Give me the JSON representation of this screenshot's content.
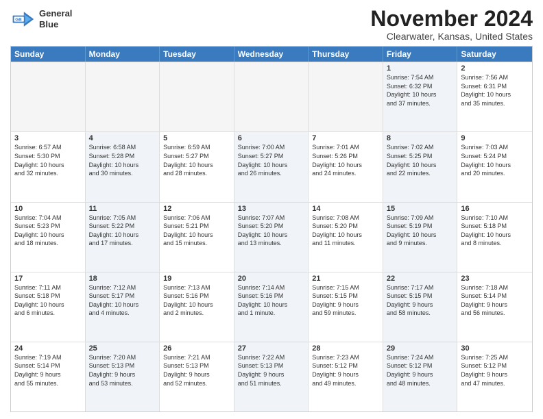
{
  "logo": {
    "line1": "General",
    "line2": "Blue"
  },
  "title": "November 2024",
  "location": "Clearwater, Kansas, United States",
  "headers": [
    "Sunday",
    "Monday",
    "Tuesday",
    "Wednesday",
    "Thursday",
    "Friday",
    "Saturday"
  ],
  "rows": [
    [
      {
        "day": "",
        "text": "",
        "empty": true
      },
      {
        "day": "",
        "text": "",
        "empty": true
      },
      {
        "day": "",
        "text": "",
        "empty": true
      },
      {
        "day": "",
        "text": "",
        "empty": true
      },
      {
        "day": "",
        "text": "",
        "empty": true
      },
      {
        "day": "1",
        "text": "Sunrise: 7:54 AM\nSunset: 6:32 PM\nDaylight: 10 hours\nand 37 minutes.",
        "empty": false,
        "alt": true
      },
      {
        "day": "2",
        "text": "Sunrise: 7:56 AM\nSunset: 6:31 PM\nDaylight: 10 hours\nand 35 minutes.",
        "empty": false
      }
    ],
    [
      {
        "day": "3",
        "text": "Sunrise: 6:57 AM\nSunset: 5:30 PM\nDaylight: 10 hours\nand 32 minutes.",
        "empty": false
      },
      {
        "day": "4",
        "text": "Sunrise: 6:58 AM\nSunset: 5:28 PM\nDaylight: 10 hours\nand 30 minutes.",
        "empty": false,
        "alt": true
      },
      {
        "day": "5",
        "text": "Sunrise: 6:59 AM\nSunset: 5:27 PM\nDaylight: 10 hours\nand 28 minutes.",
        "empty": false
      },
      {
        "day": "6",
        "text": "Sunrise: 7:00 AM\nSunset: 5:27 PM\nDaylight: 10 hours\nand 26 minutes.",
        "empty": false,
        "alt": true
      },
      {
        "day": "7",
        "text": "Sunrise: 7:01 AM\nSunset: 5:26 PM\nDaylight: 10 hours\nand 24 minutes.",
        "empty": false
      },
      {
        "day": "8",
        "text": "Sunrise: 7:02 AM\nSunset: 5:25 PM\nDaylight: 10 hours\nand 22 minutes.",
        "empty": false,
        "alt": true
      },
      {
        "day": "9",
        "text": "Sunrise: 7:03 AM\nSunset: 5:24 PM\nDaylight: 10 hours\nand 20 minutes.",
        "empty": false
      }
    ],
    [
      {
        "day": "10",
        "text": "Sunrise: 7:04 AM\nSunset: 5:23 PM\nDaylight: 10 hours\nand 18 minutes.",
        "empty": false
      },
      {
        "day": "11",
        "text": "Sunrise: 7:05 AM\nSunset: 5:22 PM\nDaylight: 10 hours\nand 17 minutes.",
        "empty": false,
        "alt": true
      },
      {
        "day": "12",
        "text": "Sunrise: 7:06 AM\nSunset: 5:21 PM\nDaylight: 10 hours\nand 15 minutes.",
        "empty": false
      },
      {
        "day": "13",
        "text": "Sunrise: 7:07 AM\nSunset: 5:20 PM\nDaylight: 10 hours\nand 13 minutes.",
        "empty": false,
        "alt": true
      },
      {
        "day": "14",
        "text": "Sunrise: 7:08 AM\nSunset: 5:20 PM\nDaylight: 10 hours\nand 11 minutes.",
        "empty": false
      },
      {
        "day": "15",
        "text": "Sunrise: 7:09 AM\nSunset: 5:19 PM\nDaylight: 10 hours\nand 9 minutes.",
        "empty": false,
        "alt": true
      },
      {
        "day": "16",
        "text": "Sunrise: 7:10 AM\nSunset: 5:18 PM\nDaylight: 10 hours\nand 8 minutes.",
        "empty": false
      }
    ],
    [
      {
        "day": "17",
        "text": "Sunrise: 7:11 AM\nSunset: 5:18 PM\nDaylight: 10 hours\nand 6 minutes.",
        "empty": false
      },
      {
        "day": "18",
        "text": "Sunrise: 7:12 AM\nSunset: 5:17 PM\nDaylight: 10 hours\nand 4 minutes.",
        "empty": false,
        "alt": true
      },
      {
        "day": "19",
        "text": "Sunrise: 7:13 AM\nSunset: 5:16 PM\nDaylight: 10 hours\nand 2 minutes.",
        "empty": false
      },
      {
        "day": "20",
        "text": "Sunrise: 7:14 AM\nSunset: 5:16 PM\nDaylight: 10 hours\nand 1 minute.",
        "empty": false,
        "alt": true
      },
      {
        "day": "21",
        "text": "Sunrise: 7:15 AM\nSunset: 5:15 PM\nDaylight: 9 hours\nand 59 minutes.",
        "empty": false
      },
      {
        "day": "22",
        "text": "Sunrise: 7:17 AM\nSunset: 5:15 PM\nDaylight: 9 hours\nand 58 minutes.",
        "empty": false,
        "alt": true
      },
      {
        "day": "23",
        "text": "Sunrise: 7:18 AM\nSunset: 5:14 PM\nDaylight: 9 hours\nand 56 minutes.",
        "empty": false
      }
    ],
    [
      {
        "day": "24",
        "text": "Sunrise: 7:19 AM\nSunset: 5:14 PM\nDaylight: 9 hours\nand 55 minutes.",
        "empty": false
      },
      {
        "day": "25",
        "text": "Sunrise: 7:20 AM\nSunset: 5:13 PM\nDaylight: 9 hours\nand 53 minutes.",
        "empty": false,
        "alt": true
      },
      {
        "day": "26",
        "text": "Sunrise: 7:21 AM\nSunset: 5:13 PM\nDaylight: 9 hours\nand 52 minutes.",
        "empty": false
      },
      {
        "day": "27",
        "text": "Sunrise: 7:22 AM\nSunset: 5:13 PM\nDaylight: 9 hours\nand 51 minutes.",
        "empty": false,
        "alt": true
      },
      {
        "day": "28",
        "text": "Sunrise: 7:23 AM\nSunset: 5:12 PM\nDaylight: 9 hours\nand 49 minutes.",
        "empty": false
      },
      {
        "day": "29",
        "text": "Sunrise: 7:24 AM\nSunset: 5:12 PM\nDaylight: 9 hours\nand 48 minutes.",
        "empty": false,
        "alt": true
      },
      {
        "day": "30",
        "text": "Sunrise: 7:25 AM\nSunset: 5:12 PM\nDaylight: 9 hours\nand 47 minutes.",
        "empty": false
      }
    ]
  ]
}
